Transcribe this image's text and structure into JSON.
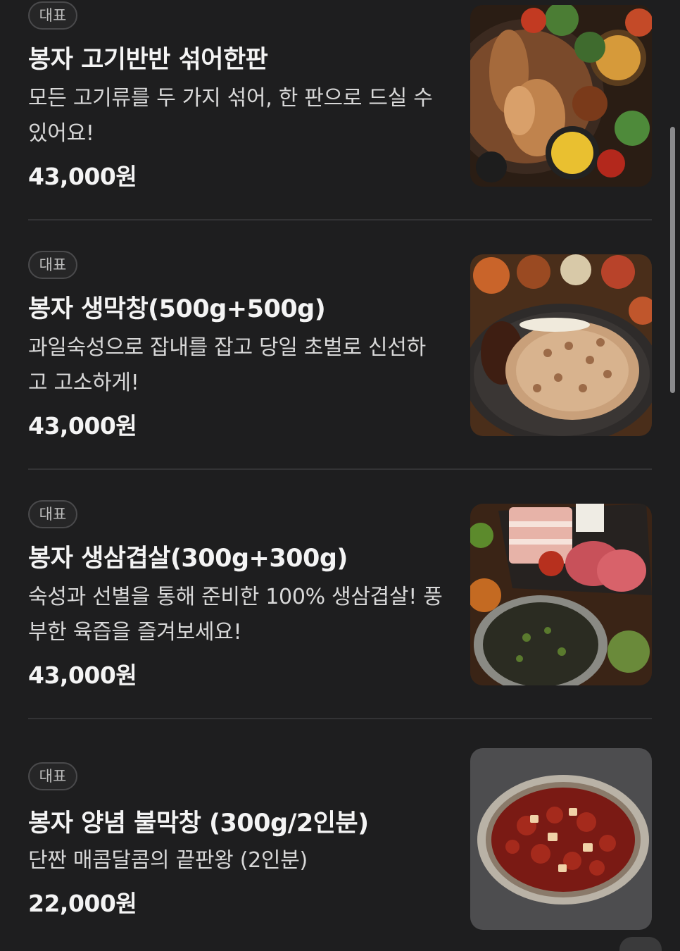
{
  "menu": {
    "items": [
      {
        "badge": "대표",
        "title": "봉자 고기반반 섞어한판",
        "description": "모든 고기류를 두 가지 섞어, 한 판으로 드실 수 있어요!",
        "price": "43,000원",
        "image_icon": "grilled-meat-platter-photo"
      },
      {
        "badge": "대표",
        "title": "봉자 생막창(500g+500g)",
        "description": "과일숙성으로 잡내를 잡고 당일 초벌로 신선하고 고소하게!",
        "price": "43,000원",
        "image_icon": "raw-makchang-photo"
      },
      {
        "badge": "대표",
        "title": "봉자 생삼겹살(300g+300g)",
        "description": "숙성과 선별을 통해 준비한 100% 생삼겹살! 풍부한 육즙을 즐겨보세요!",
        "price": "43,000원",
        "image_icon": "pork-belly-photo"
      },
      {
        "badge": "대표",
        "title": "봉자 양념 불막창 (300g/2인분)",
        "description": "단짠 매콤달콤의 끝판왕 (2인분)",
        "price": "22,000원",
        "image_icon": "spicy-makchang-photo"
      }
    ]
  },
  "colors": {
    "background": "#1e1e1f",
    "text_primary": "#f4f4f4",
    "text_secondary": "#d8d8d8",
    "badge_border": "#4a4a4c",
    "divider": "#333335"
  }
}
